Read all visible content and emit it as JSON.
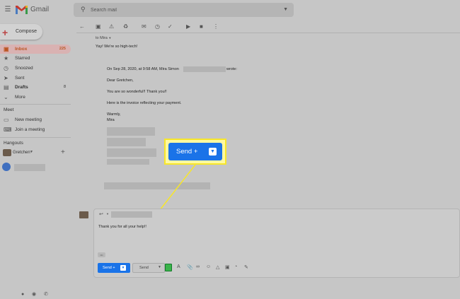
{
  "app": {
    "logo_text": "Gmail"
  },
  "search": {
    "placeholder": "Search mail"
  },
  "sidebar": {
    "compose_label": "Compose",
    "items": [
      {
        "label": "Inbox",
        "count": "225",
        "icon": "inbox-icon"
      },
      {
        "label": "Starred",
        "count": "",
        "icon": "star-icon"
      },
      {
        "label": "Snoozed",
        "count": "",
        "icon": "clock-icon"
      },
      {
        "label": "Sent",
        "count": "",
        "icon": "send-icon"
      },
      {
        "label": "Drafts",
        "count": "8",
        "icon": "draft-icon"
      },
      {
        "label": "More",
        "count": "",
        "icon": "chevron-down-icon"
      }
    ],
    "meet_title": "Meet",
    "meet_items": [
      {
        "label": "New meeting",
        "icon": "video-icon"
      },
      {
        "label": "Join a meeting",
        "icon": "keyboard-icon"
      }
    ],
    "hangouts_title": "Hangouts",
    "hangouts_user": "Gretchen"
  },
  "message": {
    "to_line": "to Mira",
    "reply_text": "Yay! We're so high-tech!",
    "quote_header": "On Sep 28, 2020, at 9:58 AM, Mira Simon",
    "quote_wrote": "wrote:",
    "greeting": "Dear Gretchen,",
    "line1": "You are so wonderful!! Thank you!!",
    "line2": "Here is the invoice reflecting your payment.",
    "closing": "Warmly,",
    "signature": "Mira"
  },
  "callout": {
    "send_label": "Send +"
  },
  "reply": {
    "body": "Thank you for all your help!!",
    "ellipsis": "•••",
    "send_label": "Send +",
    "secondary_send_label": "Send"
  },
  "colors": {
    "accent": "#1a73e8",
    "callout_border": "#f7e62a",
    "inbox": "#b52"
  }
}
